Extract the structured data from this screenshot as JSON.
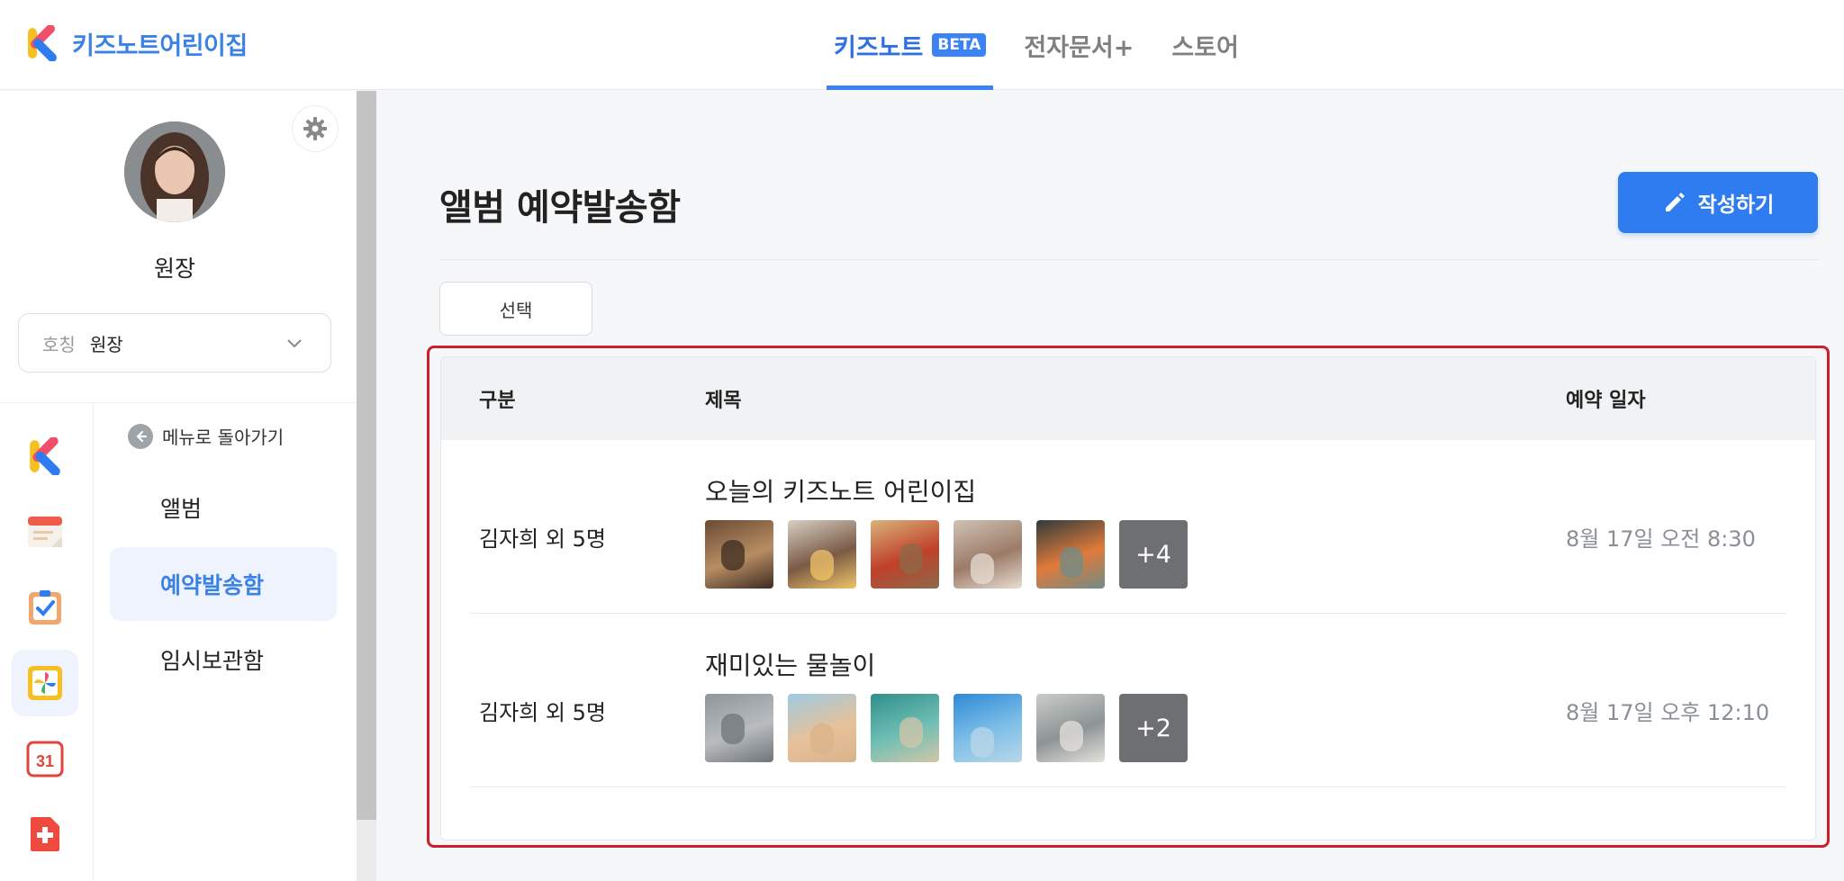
{
  "app": {
    "name": "키즈노트어린이집"
  },
  "topnav": {
    "items": [
      {
        "label": "키즈노트",
        "badge": "BETA",
        "active": true
      },
      {
        "label": "전자문서+"
      },
      {
        "label": "스토어"
      }
    ]
  },
  "profile": {
    "name": "원장",
    "title_label": "호칭",
    "title_value": "원장"
  },
  "rail": {
    "items": [
      {
        "icon": "kidsnote-logo-icon"
      },
      {
        "icon": "notice-icon"
      },
      {
        "icon": "checklist-icon"
      },
      {
        "icon": "album-pinwheel-icon",
        "active": true
      },
      {
        "icon": "calendar-icon",
        "text": "31"
      },
      {
        "icon": "medication-icon"
      }
    ]
  },
  "menu": {
    "back_label": "메뉴로 돌아가기",
    "items": [
      {
        "label": "앨범"
      },
      {
        "label": "예약발송함",
        "active": true
      },
      {
        "label": "임시보관함"
      }
    ]
  },
  "main": {
    "page_title": "앨범 예약발송함",
    "write_label": "작성하기",
    "select_label": "선택",
    "columns": {
      "sender": "구분",
      "title": "제목",
      "date": "예약 일자"
    },
    "rows": [
      {
        "sender": "김자희 외 5명",
        "title": "오늘의 키즈노트 어린이집",
        "date": "8월 17일 오전 8:30",
        "thumbs": [
          {
            "colors": [
              "#6b4a34",
              "#b78d63",
              "#3d2b22"
            ]
          },
          {
            "colors": [
              "#d8cfc3",
              "#7a5a45",
              "#f0c46a"
            ]
          },
          {
            "colors": [
              "#d9b37a",
              "#c0402a",
              "#8c6a4a"
            ]
          },
          {
            "colors": [
              "#cfc2b4",
              "#9c7b68",
              "#e8ded3"
            ]
          },
          {
            "colors": [
              "#2e3b3a",
              "#e07a3a",
              "#6e8c8a"
            ]
          }
        ],
        "more": "+4"
      },
      {
        "sender": "김자희 외 5명",
        "title": "재미있는 물놀이",
        "date": "8월 17일 오후 12:10",
        "thumbs": [
          {
            "colors": [
              "#8f959a",
              "#b8bcbf",
              "#6f7478"
            ]
          },
          {
            "colors": [
              "#9ecbe2",
              "#e6c19a",
              "#d9b38a"
            ]
          },
          {
            "colors": [
              "#2f8f8a",
              "#6fbfb5",
              "#d3c6a8"
            ]
          },
          {
            "colors": [
              "#2d8ad6",
              "#7fbfe8",
              "#b9d7e8"
            ]
          },
          {
            "colors": [
              "#c9ccc9",
              "#8d9495",
              "#e4e2dc"
            ]
          }
        ],
        "more": "+2"
      }
    ]
  },
  "colors": {
    "accent": "#3b82f6",
    "highlight": "#cc1f2d"
  }
}
